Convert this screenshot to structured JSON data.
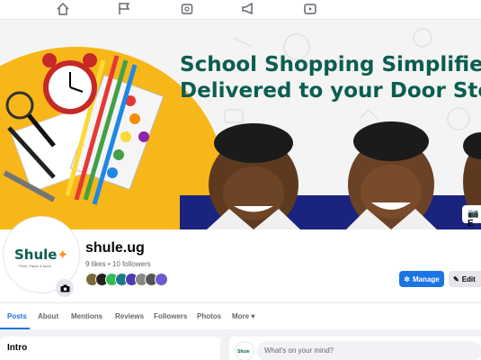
{
  "topnav": {
    "icons": [
      "home-icon",
      "flag-icon",
      "marketplace-icon",
      "megaphone-icon",
      "video-icon"
    ]
  },
  "cover": {
    "headline_line1": "School Shopping Simplifie",
    "headline_line2": "Delivered to your Door Ste",
    "edit_label": "E"
  },
  "profile": {
    "logo_text": "Shule",
    "logo_tagline": "Pens, Paper & More",
    "name": "shule.ug",
    "stats": "9 likes • 10 followers"
  },
  "actions": {
    "manage_label": "Manage",
    "edit_label": "Edit"
  },
  "tabs": [
    "Posts",
    "About",
    "Mentions",
    "Reviews",
    "Followers",
    "Photos",
    "More ▾"
  ],
  "intro": {
    "title": "Intro"
  },
  "composer": {
    "avatar_text": "Shule",
    "placeholder": "What's on your mind?"
  },
  "colors": {
    "brand_green": "#0b5e4f",
    "accent_blue": "#1b74e4",
    "cover_yellow": "#f7b718"
  }
}
